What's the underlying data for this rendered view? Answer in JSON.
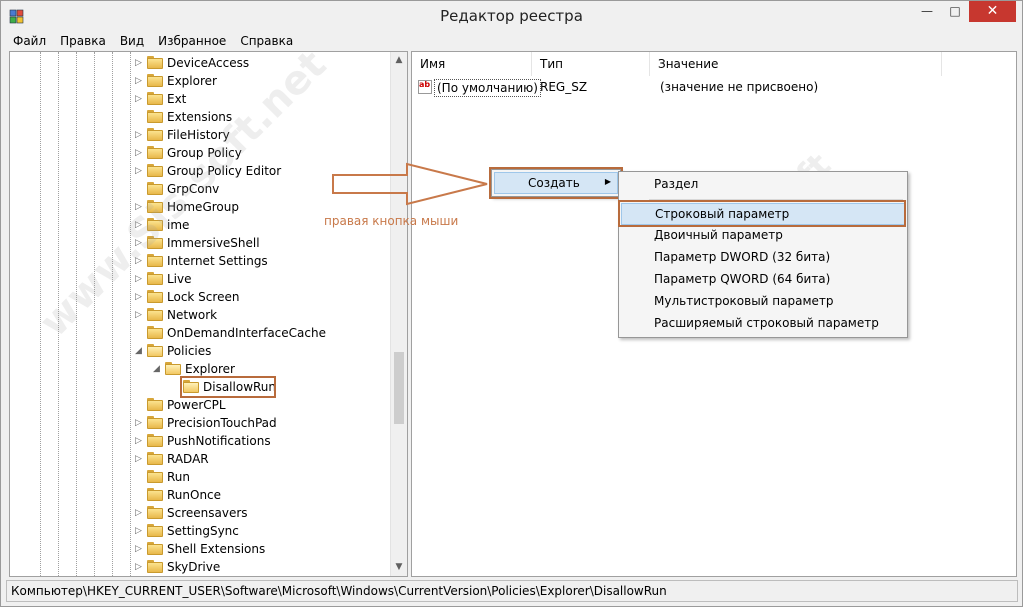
{
  "window": {
    "title": "Редактор реестра",
    "controls": {
      "minimize": "—",
      "maximize": "□",
      "close": "✕"
    }
  },
  "menu": [
    "Файл",
    "Правка",
    "Вид",
    "Избранное",
    "Справка"
  ],
  "tree": [
    {
      "label": "DeviceAccess",
      "expander": "▷"
    },
    {
      "label": "Explorer",
      "expander": "▷"
    },
    {
      "label": "Ext",
      "expander": "▷"
    },
    {
      "label": "Extensions",
      "expander": ""
    },
    {
      "label": "FileHistory",
      "expander": "▷"
    },
    {
      "label": "Group Policy",
      "expander": "▷"
    },
    {
      "label": "Group Policy Editor",
      "expander": "▷"
    },
    {
      "label": "GrpConv",
      "expander": ""
    },
    {
      "label": "HomeGroup",
      "expander": "▷"
    },
    {
      "label": "ime",
      "expander": "▷"
    },
    {
      "label": "ImmersiveShell",
      "expander": "▷"
    },
    {
      "label": "Internet Settings",
      "expander": "▷"
    },
    {
      "label": "Live",
      "expander": "▷"
    },
    {
      "label": "Lock Screen",
      "expander": "▷"
    },
    {
      "label": "Network",
      "expander": "▷"
    },
    {
      "label": "OnDemandInterfaceCache",
      "expander": ""
    },
    {
      "label": "Policies",
      "expander": "◢"
    },
    {
      "label": "Explorer",
      "expander": "◢"
    },
    {
      "label": "DisallowRun",
      "expander": ""
    },
    {
      "label": "PowerCPL",
      "expander": ""
    },
    {
      "label": "PrecisionTouchPad",
      "expander": "▷"
    },
    {
      "label": "PushNotifications",
      "expander": "▷"
    },
    {
      "label": "RADAR",
      "expander": "▷"
    },
    {
      "label": "Run",
      "expander": ""
    },
    {
      "label": "RunOnce",
      "expander": ""
    },
    {
      "label": "Screensavers",
      "expander": "▷"
    },
    {
      "label": "SettingSync",
      "expander": "▷"
    },
    {
      "label": "Shell Extensions",
      "expander": "▷"
    },
    {
      "label": "SkyDrive",
      "expander": "▷"
    }
  ],
  "list": {
    "columns": [
      "Имя",
      "Тип",
      "Значение"
    ],
    "rows": [
      {
        "icon": "ab",
        "name": "(По умолчанию)",
        "type": "REG_SZ",
        "value": "(значение не присвоено)"
      }
    ]
  },
  "annotation": "правая кнопка мыши",
  "context_menu": {
    "create": {
      "label": "Создать",
      "arrow": "▶"
    },
    "submenu": [
      "Раздел",
      "Строковый параметр",
      "Двоичный параметр",
      "Параметр DWORD (32 бита)",
      "Параметр QWORD (64 бита)",
      "Мультистроковый параметр",
      "Расширяемый строковый параметр"
    ]
  },
  "status": "Компьютер\\HKEY_CURRENT_USER\\Software\\Microsoft\\Windows\\CurrentVersion\\Policies\\Explorer\\DisallowRun",
  "watermark": [
    "www.Sis-soft.net",
    "Sis-soft"
  ],
  "colors": {
    "highlight_outline": "#b86b3c",
    "menu_hover": "#d5e6f5",
    "close_button": "#c7372f",
    "annotation": "#c8794a"
  }
}
